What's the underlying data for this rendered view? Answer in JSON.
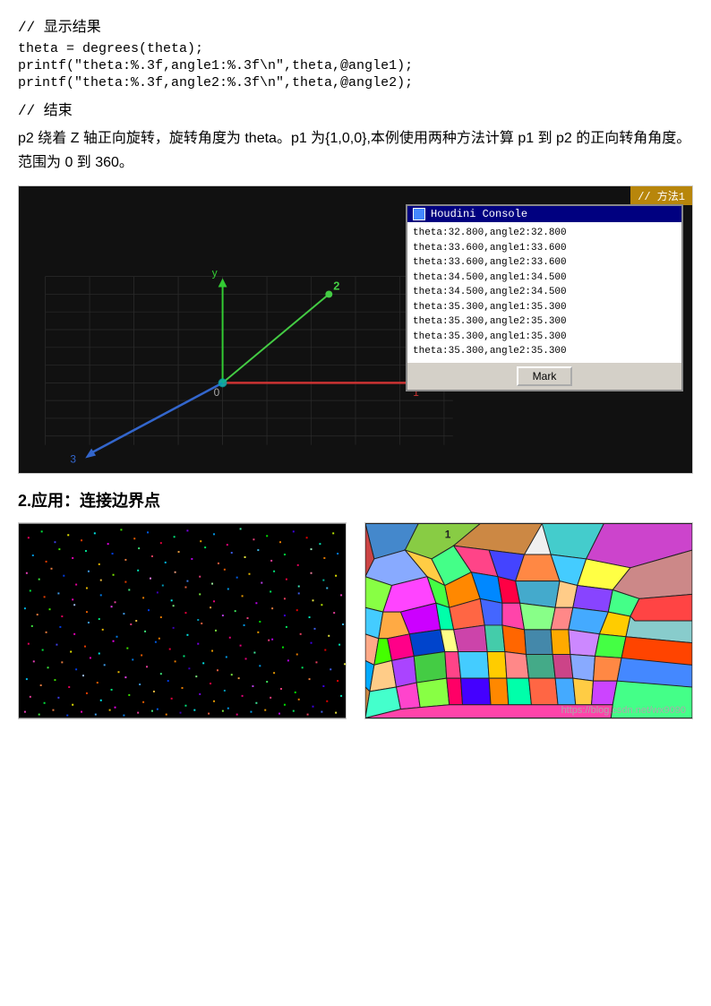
{
  "code": {
    "comment1": "//  显示结果",
    "line1": "theta = degrees(theta);",
    "line2": "printf(\"theta:%.3f,angle1:%.3f\\n\",theta,@angle1);",
    "line3": "printf(\"theta:%.3f,angle2:%.3f\\n\",theta,@angle2);",
    "comment2": "//  结束"
  },
  "description": {
    "text": "p2 绕着 Z 轴正向旋转，旋转角度为 theta。p1 为{1,0,0},本例使用两种方法计算 p1 到 p2 的正向转角角度。范围为 0 到 360。"
  },
  "console": {
    "title": "Houdini Console",
    "lines": [
      "theta:32.800,angle2:32.800",
      "theta:33.600,angle1:33.600",
      "theta:33.600,angle2:33.600",
      "theta:34.500,angle1:34.500",
      "theta:34.500,angle2:34.500",
      "theta:35.300,angle1:35.300",
      "theta:35.300,angle2:35.300",
      "theta:35.300,angle1:35.300",
      "theta:35.300,angle2:35.300"
    ],
    "mark_button": "Mark"
  },
  "badge": {
    "text": "// 方法1"
  },
  "section2": {
    "heading": "2.应用：连接边界点"
  },
  "watermark": {
    "text": "https://blog.csdn.net/wx9090"
  }
}
